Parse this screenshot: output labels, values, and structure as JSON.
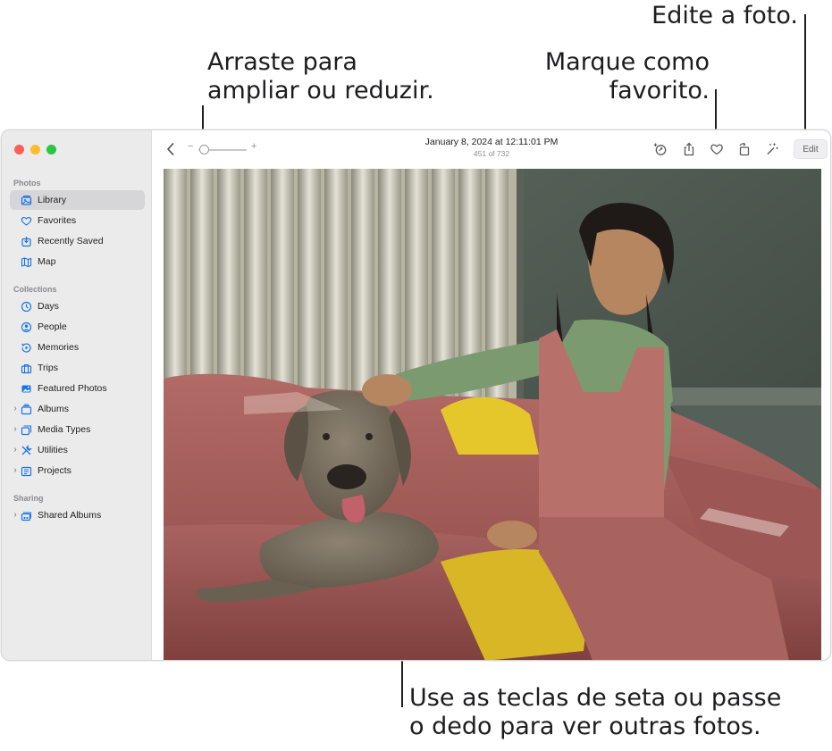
{
  "callouts": {
    "zoom": [
      "Arraste para",
      "ampliar ou reduzir."
    ],
    "favorite": [
      "Marque como",
      "favorito."
    ],
    "edit": [
      "Edite a foto."
    ],
    "arrows": [
      "Use as teclas de seta ou passe",
      "o dedo para ver outras fotos."
    ]
  },
  "sidebar": {
    "sections": {
      "photos": "Photos",
      "collections": "Collections",
      "sharing": "Sharing"
    },
    "items": [
      {
        "label": "Library",
        "icon": "library-icon"
      },
      {
        "label": "Favorites",
        "icon": "heart-icon"
      },
      {
        "label": "Recently Saved",
        "icon": "recently-saved-icon"
      },
      {
        "label": "Map",
        "icon": "map-icon"
      },
      {
        "label": "Days",
        "icon": "clock-icon"
      },
      {
        "label": "People",
        "icon": "person-icon"
      },
      {
        "label": "Memories",
        "icon": "memories-icon"
      },
      {
        "label": "Trips",
        "icon": "suitcase-icon"
      },
      {
        "label": "Featured Photos",
        "icon": "photo-icon"
      },
      {
        "label": "Albums",
        "icon": "albums-icon"
      },
      {
        "label": "Media Types",
        "icon": "media-types-icon"
      },
      {
        "label": "Utilities",
        "icon": "utilities-icon"
      },
      {
        "label": "Projects",
        "icon": "projects-icon"
      },
      {
        "label": "Shared Albums",
        "icon": "shared-albums-icon"
      }
    ],
    "expand_glyph": "›"
  },
  "toolbar": {
    "date": "January 8, 2024 at 12:11:01 PM",
    "count": "451 of 732",
    "zoom_minus": "−",
    "zoom_plus": "+",
    "edit_label": "Edit"
  },
  "colors": {
    "accent": "#1a73e8",
    "sidebar_bg": "#ebebeb"
  }
}
